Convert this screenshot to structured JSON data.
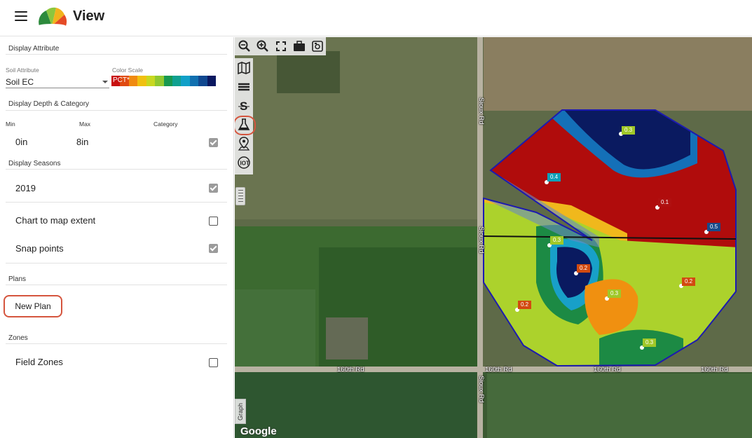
{
  "header": {
    "title": "View",
    "menu_icon": "hamburger-menu-icon",
    "logo_icon": "fan-logo-icon"
  },
  "panel": {
    "display_attribute": {
      "section_title": "Display Attribute",
      "soil_attribute_label": "Soil Attribute",
      "soil_attribute_value": "Soil EC",
      "color_scale_label": "Color Scale",
      "color_scale_value": "PCT*",
      "color_scale_colors": [
        "#c81010",
        "#e04a10",
        "#f08a10",
        "#f0c010",
        "#c8d820",
        "#90c830",
        "#189850",
        "#10a090",
        "#10a0c8",
        "#1070b0",
        "#104890",
        "#0a1860"
      ]
    },
    "depth": {
      "section_title": "Display Depth & Category",
      "min_label": "Min",
      "max_label": "Max",
      "category_label": "Category",
      "min_value": "0in",
      "max_value": "8in",
      "category_checked": true
    },
    "seasons": {
      "section_title": "Display Seasons",
      "items": [
        {
          "label": "2019",
          "checked": true
        }
      ]
    },
    "options": [
      {
        "label": "Chart to map extent",
        "checked": false
      },
      {
        "label": "Snap points",
        "checked": true
      }
    ],
    "plans": {
      "section_title": "Plans",
      "new_plan_label": "New Plan"
    },
    "zones": {
      "section_title": "Zones",
      "field_zones_label": "Field Zones",
      "field_zones_checked": false
    }
  },
  "map": {
    "toolbar_top": [
      "zoom-out-icon",
      "zoom-in-icon",
      "fullscreen-icon",
      "briefcase-icon",
      "screenshot-icon"
    ],
    "toolbar_left": [
      "map-layers-icon",
      "stack-layers-icon",
      "soil-s-icon",
      "lab-flask-icon",
      "location-pin-icon",
      "iot-sensor-icon"
    ],
    "active_tool": "lab-flask-icon",
    "graph_label": "Graph",
    "google_label": "Google",
    "roads": {
      "horizontal": "160th Rd",
      "vertical": "Sioux Rd"
    },
    "points": [
      {
        "label": "0.3",
        "color": "#a0c828"
      },
      {
        "label": "0.4",
        "color": "#10a0b8"
      },
      {
        "label": "0.1",
        "color": "#b01010"
      },
      {
        "label": "0.5",
        "color": "#184a8a"
      },
      {
        "label": "0.3",
        "color": "#a0c828"
      },
      {
        "label": "0.2",
        "color": "#d24a10"
      },
      {
        "label": "0.2",
        "color": "#d24a10"
      },
      {
        "label": "0.3",
        "color": "#a0c828"
      },
      {
        "label": "0.2",
        "color": "#d24a10"
      },
      {
        "label": "0.3",
        "color": "#a0c828"
      }
    ]
  }
}
